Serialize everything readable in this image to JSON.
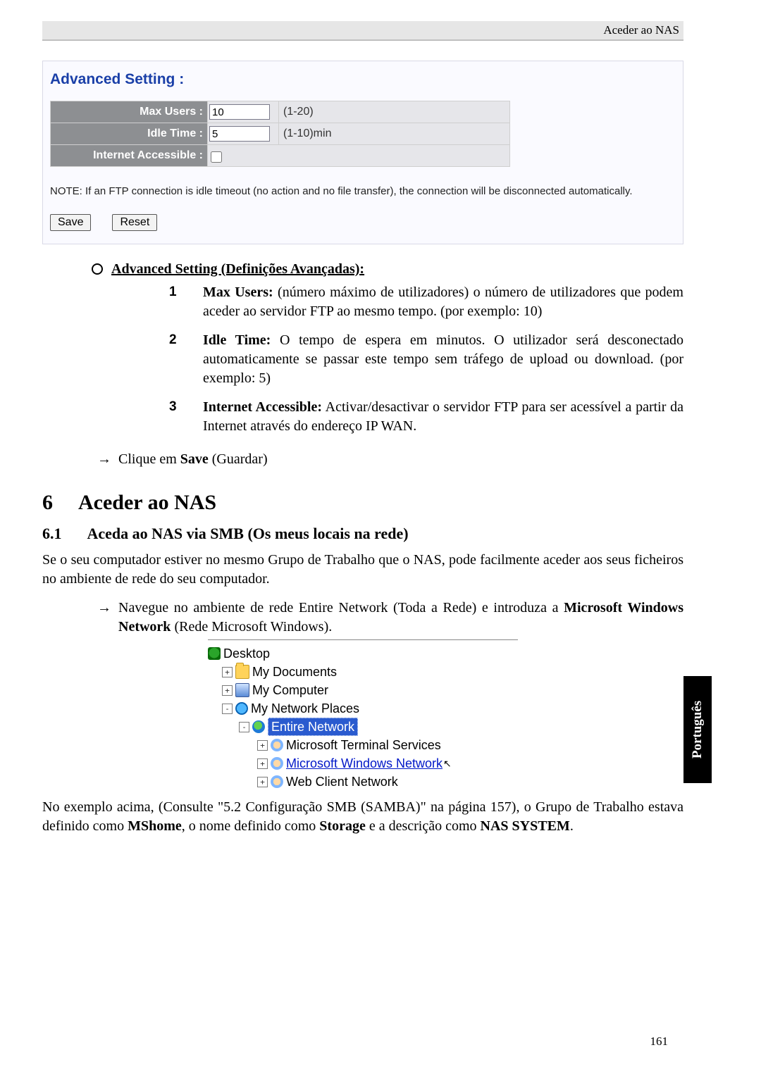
{
  "header": {
    "title": "Aceder ao NAS"
  },
  "panel": {
    "title": "Advanced Setting  :",
    "rows": {
      "max_users": {
        "label": "Max Users :",
        "value": "10",
        "hint": "(1-20)"
      },
      "idle_time": {
        "label": "Idle Time :",
        "value": "5",
        "hint": "(1-10)min"
      },
      "internet": {
        "label": "Internet Accessible :",
        "checked": false,
        "hint": ""
      }
    },
    "note": "NOTE: If an FTP connection is idle timeout (no action and no file transfer), the connection will be disconnected automatically.",
    "buttons": {
      "save": "Save",
      "reset": "Reset"
    }
  },
  "doc": {
    "bullet_head": "Advanced Setting (Definições Avançadas):",
    "list": [
      {
        "bold": "Max Users:",
        "text": " (número máximo de utilizadores) o número de utilizadores que podem aceder ao servidor FTP ao mesmo tempo. (por exemplo: 10)"
      },
      {
        "bold": "Idle Time:",
        "text": " O tempo de espera em minutos. O utilizador será desconectado automaticamente se passar este tempo sem tráfego de upload ou download. (por exemplo: 5)"
      },
      {
        "bold": "Internet Accessible:",
        "text": " Activar/desactivar o servidor FTP para ser acessível a partir da Internet através do endereço IP WAN."
      }
    ],
    "save_line": {
      "pre": "Clique em ",
      "bold": "Save",
      "post": " (Guardar)"
    },
    "h1": {
      "num": "6",
      "title": "Aceder ao NAS"
    },
    "h2": {
      "num": "6.1",
      "title": "Aceda ao NAS via SMB (Os meus locais na rede)"
    },
    "intro": "Se o seu computador estiver no mesmo Grupo de Trabalho que o NAS, pode facilmente aceder aos seus ficheiros no ambiente de rede do seu computador.",
    "nav_line": {
      "pre": "Navegue no ambiente de rede Entire Network (Toda a Rede) e introduza a ",
      "bold1": "Microsoft Windows Network",
      "post": " (Rede Microsoft Windows)."
    },
    "tree": {
      "desktop": "Desktop",
      "mydocs": "My Documents",
      "mycomp": "My Computer",
      "netplaces": "My Network Places",
      "entire": "Entire Network",
      "term": "Microsoft Terminal Services",
      "mswin": "Microsoft Windows Network",
      "webclient": "Web Client Network"
    },
    "outro": {
      "pre": "No exemplo acima, (Consulte \"5.2 Configuração SMB (SAMBA)\" na página 157), o Grupo de Trabalho estava definido como ",
      "b1": "MShome",
      "mid1": ", o nome definido como ",
      "b2": "Storage",
      "mid2": " e a descrição como ",
      "b3": "NAS SYSTEM",
      "post": "."
    }
  },
  "lang_tab": "Português",
  "page_number": "161"
}
